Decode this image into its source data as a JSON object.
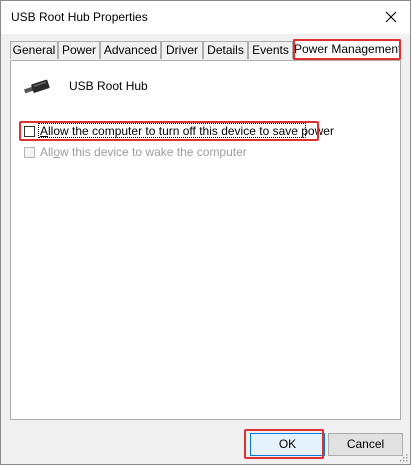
{
  "window": {
    "title": "USB Root Hub Properties"
  },
  "tabs": [
    {
      "label": "General"
    },
    {
      "label": "Power"
    },
    {
      "label": "Advanced"
    },
    {
      "label": "Driver"
    },
    {
      "label": "Details"
    },
    {
      "label": "Events"
    },
    {
      "label": "Power Management",
      "active": true
    }
  ],
  "device": {
    "name": "USB Root Hub",
    "icon": "usb-connector-icon"
  },
  "options": [
    {
      "label_accel": "A",
      "label_rest": "llow the computer to turn off this device to save power",
      "checked": false,
      "enabled": true
    },
    {
      "label_pre": "All",
      "label_accel": "o",
      "label_rest": "w this device to wake the computer",
      "checked": false,
      "enabled": false
    }
  ],
  "buttons": {
    "ok": "OK",
    "cancel": "Cancel"
  },
  "colors": {
    "highlight": "#e03030",
    "focus_accent": "#0078d7"
  }
}
